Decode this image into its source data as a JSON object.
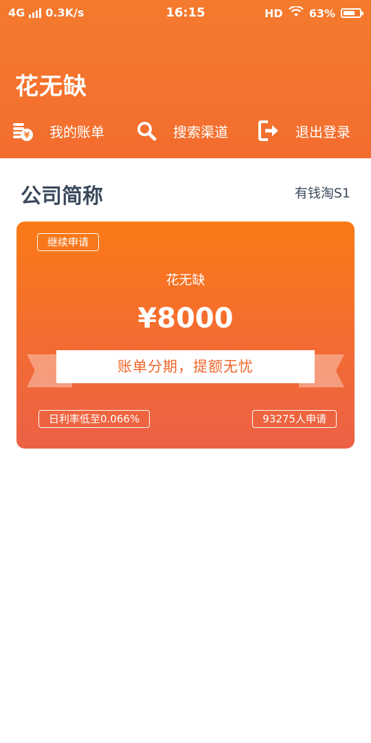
{
  "status_bar": {
    "network": "4G",
    "speed": "0.3K/s",
    "time": "16:15",
    "hd": "HD",
    "battery": "63%"
  },
  "header": {
    "app_title": "花无缺",
    "nav": [
      {
        "label": "我的账单",
        "icon": "coin-bill-icon"
      },
      {
        "label": "搜索渠道",
        "icon": "search-icon"
      },
      {
        "label": "退出登录",
        "icon": "logout-icon"
      }
    ]
  },
  "section": {
    "company": "公司简称",
    "company_sub": "有钱淘S1"
  },
  "card": {
    "continue_tag": "继续申请",
    "name": "花无缺",
    "amount": "¥8000",
    "slogan": "账单分期，提额无忧",
    "rate": "日利率低至0.066%",
    "applicants": "93275人申请"
  },
  "colors": {
    "header_orange": "#f47a2d",
    "card_top": "#fb7a16",
    "card_bottom": "#ec6145",
    "accent_text": "#f0652a",
    "dark_text": "#3a4a5c"
  }
}
